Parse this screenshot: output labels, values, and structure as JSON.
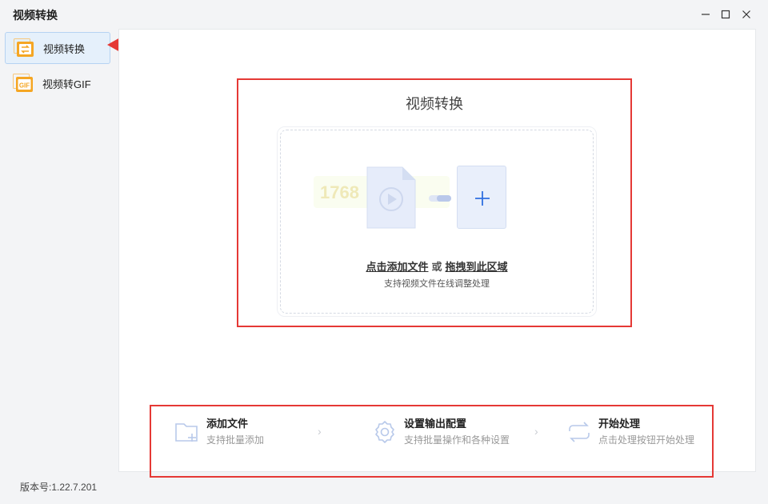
{
  "window": {
    "title": "视频转换",
    "controls": [
      "minimize-icon",
      "maximize-icon",
      "close-icon"
    ]
  },
  "sidebar": {
    "items": [
      {
        "label": "视频转换",
        "icon": "video-convert-icon",
        "active": true
      },
      {
        "label": "视频转GIF",
        "icon": "gif-icon",
        "active": false
      }
    ],
    "version": "版本号:1.22.7.201"
  },
  "drop_area": {
    "title": "视频转换",
    "add_link": "点击添加文件",
    "or_text": "或",
    "drag_link": "拖拽到此区域",
    "subtitle": "支持视频文件在线调整处理",
    "faded_text": "1768"
  },
  "steps": [
    {
      "title": "添加文件",
      "desc": "支持批量添加",
      "icon": "folder-add-icon"
    },
    {
      "title": "设置输出配置",
      "desc": "支持批量操作和各种设置",
      "icon": "gear-icon"
    },
    {
      "title": "开始处理",
      "desc": "点击处理按钮开始处理",
      "icon": "repeat-icon"
    }
  ],
  "colors": {
    "accent": "#2f6fe0",
    "highlight_border": "#e53935",
    "active_bg": "#e5f0fb",
    "icon_orange": "#f5a623",
    "step_icon": "#b8c9ea"
  }
}
